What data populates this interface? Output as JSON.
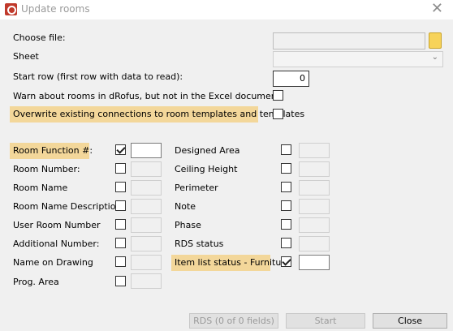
{
  "window": {
    "title": "Update rooms",
    "close_glyph": "✕"
  },
  "file": {
    "label": "Choose file:",
    "value": ""
  },
  "sheet": {
    "label": "Sheet",
    "value": ""
  },
  "start_row": {
    "label": "Start row (first row with data to read):",
    "value": "0"
  },
  "warn": {
    "label": "Warn about rooms in dRofus, but not in the Excel document",
    "checked": false
  },
  "overwrite": {
    "label": "Overwrite existing connections to room templates and templates",
    "checked": false
  },
  "fields_left": [
    {
      "label": "Room Function #:",
      "checked": true
    },
    {
      "label": "Room Number:",
      "checked": false
    },
    {
      "label": "Room Name",
      "checked": false
    },
    {
      "label": "Room Name Description",
      "checked": false
    },
    {
      "label": "User Room Number",
      "checked": false
    },
    {
      "label": "Additional Number:",
      "checked": false
    },
    {
      "label": "Name on Drawing",
      "checked": false
    },
    {
      "label": "Prog. Area",
      "checked": false
    }
  ],
  "fields_right": [
    {
      "label": "Designed Area",
      "checked": false
    },
    {
      "label": "Ceiling Height",
      "checked": false
    },
    {
      "label": "Perimeter",
      "checked": false
    },
    {
      "label": "Note",
      "checked": false
    },
    {
      "label": "Phase",
      "checked": false
    },
    {
      "label": "RDS status",
      "checked": false
    },
    {
      "label": "Item list status - Furniture",
      "checked": true
    }
  ],
  "buttons": {
    "rds": "RDS  (0 of 0 fields)",
    "start": "Start",
    "close": "Close"
  },
  "colors": {
    "highlight": "#f3d79a",
    "folder": "#f7d35a",
    "app_icon": "#c0392b"
  }
}
